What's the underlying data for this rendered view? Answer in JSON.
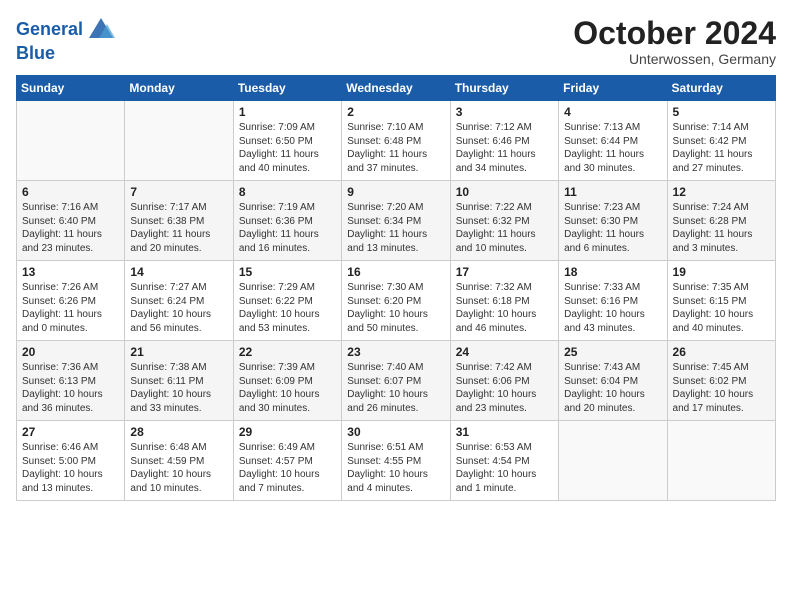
{
  "logo": {
    "line1": "General",
    "line2": "Blue"
  },
  "header": {
    "month": "October 2024",
    "location": "Unterwossen, Germany"
  },
  "weekdays": [
    "Sunday",
    "Monday",
    "Tuesday",
    "Wednesday",
    "Thursday",
    "Friday",
    "Saturday"
  ],
  "weeks": [
    [
      {
        "day": "",
        "info": ""
      },
      {
        "day": "",
        "info": ""
      },
      {
        "day": "1",
        "info": "Sunrise: 7:09 AM\nSunset: 6:50 PM\nDaylight: 11 hours and 40 minutes."
      },
      {
        "day": "2",
        "info": "Sunrise: 7:10 AM\nSunset: 6:48 PM\nDaylight: 11 hours and 37 minutes."
      },
      {
        "day": "3",
        "info": "Sunrise: 7:12 AM\nSunset: 6:46 PM\nDaylight: 11 hours and 34 minutes."
      },
      {
        "day": "4",
        "info": "Sunrise: 7:13 AM\nSunset: 6:44 PM\nDaylight: 11 hours and 30 minutes."
      },
      {
        "day": "5",
        "info": "Sunrise: 7:14 AM\nSunset: 6:42 PM\nDaylight: 11 hours and 27 minutes."
      }
    ],
    [
      {
        "day": "6",
        "info": "Sunrise: 7:16 AM\nSunset: 6:40 PM\nDaylight: 11 hours and 23 minutes."
      },
      {
        "day": "7",
        "info": "Sunrise: 7:17 AM\nSunset: 6:38 PM\nDaylight: 11 hours and 20 minutes."
      },
      {
        "day": "8",
        "info": "Sunrise: 7:19 AM\nSunset: 6:36 PM\nDaylight: 11 hours and 16 minutes."
      },
      {
        "day": "9",
        "info": "Sunrise: 7:20 AM\nSunset: 6:34 PM\nDaylight: 11 hours and 13 minutes."
      },
      {
        "day": "10",
        "info": "Sunrise: 7:22 AM\nSunset: 6:32 PM\nDaylight: 11 hours and 10 minutes."
      },
      {
        "day": "11",
        "info": "Sunrise: 7:23 AM\nSunset: 6:30 PM\nDaylight: 11 hours and 6 minutes."
      },
      {
        "day": "12",
        "info": "Sunrise: 7:24 AM\nSunset: 6:28 PM\nDaylight: 11 hours and 3 minutes."
      }
    ],
    [
      {
        "day": "13",
        "info": "Sunrise: 7:26 AM\nSunset: 6:26 PM\nDaylight: 11 hours and 0 minutes."
      },
      {
        "day": "14",
        "info": "Sunrise: 7:27 AM\nSunset: 6:24 PM\nDaylight: 10 hours and 56 minutes."
      },
      {
        "day": "15",
        "info": "Sunrise: 7:29 AM\nSunset: 6:22 PM\nDaylight: 10 hours and 53 minutes."
      },
      {
        "day": "16",
        "info": "Sunrise: 7:30 AM\nSunset: 6:20 PM\nDaylight: 10 hours and 50 minutes."
      },
      {
        "day": "17",
        "info": "Sunrise: 7:32 AM\nSunset: 6:18 PM\nDaylight: 10 hours and 46 minutes."
      },
      {
        "day": "18",
        "info": "Sunrise: 7:33 AM\nSunset: 6:16 PM\nDaylight: 10 hours and 43 minutes."
      },
      {
        "day": "19",
        "info": "Sunrise: 7:35 AM\nSunset: 6:15 PM\nDaylight: 10 hours and 40 minutes."
      }
    ],
    [
      {
        "day": "20",
        "info": "Sunrise: 7:36 AM\nSunset: 6:13 PM\nDaylight: 10 hours and 36 minutes."
      },
      {
        "day": "21",
        "info": "Sunrise: 7:38 AM\nSunset: 6:11 PM\nDaylight: 10 hours and 33 minutes."
      },
      {
        "day": "22",
        "info": "Sunrise: 7:39 AM\nSunset: 6:09 PM\nDaylight: 10 hours and 30 minutes."
      },
      {
        "day": "23",
        "info": "Sunrise: 7:40 AM\nSunset: 6:07 PM\nDaylight: 10 hours and 26 minutes."
      },
      {
        "day": "24",
        "info": "Sunrise: 7:42 AM\nSunset: 6:06 PM\nDaylight: 10 hours and 23 minutes."
      },
      {
        "day": "25",
        "info": "Sunrise: 7:43 AM\nSunset: 6:04 PM\nDaylight: 10 hours and 20 minutes."
      },
      {
        "day": "26",
        "info": "Sunrise: 7:45 AM\nSunset: 6:02 PM\nDaylight: 10 hours and 17 minutes."
      }
    ],
    [
      {
        "day": "27",
        "info": "Sunrise: 6:46 AM\nSunset: 5:00 PM\nDaylight: 10 hours and 13 minutes."
      },
      {
        "day": "28",
        "info": "Sunrise: 6:48 AM\nSunset: 4:59 PM\nDaylight: 10 hours and 10 minutes."
      },
      {
        "day": "29",
        "info": "Sunrise: 6:49 AM\nSunset: 4:57 PM\nDaylight: 10 hours and 7 minutes."
      },
      {
        "day": "30",
        "info": "Sunrise: 6:51 AM\nSunset: 4:55 PM\nDaylight: 10 hours and 4 minutes."
      },
      {
        "day": "31",
        "info": "Sunrise: 6:53 AM\nSunset: 4:54 PM\nDaylight: 10 hours and 1 minute."
      },
      {
        "day": "",
        "info": ""
      },
      {
        "day": "",
        "info": ""
      }
    ]
  ]
}
